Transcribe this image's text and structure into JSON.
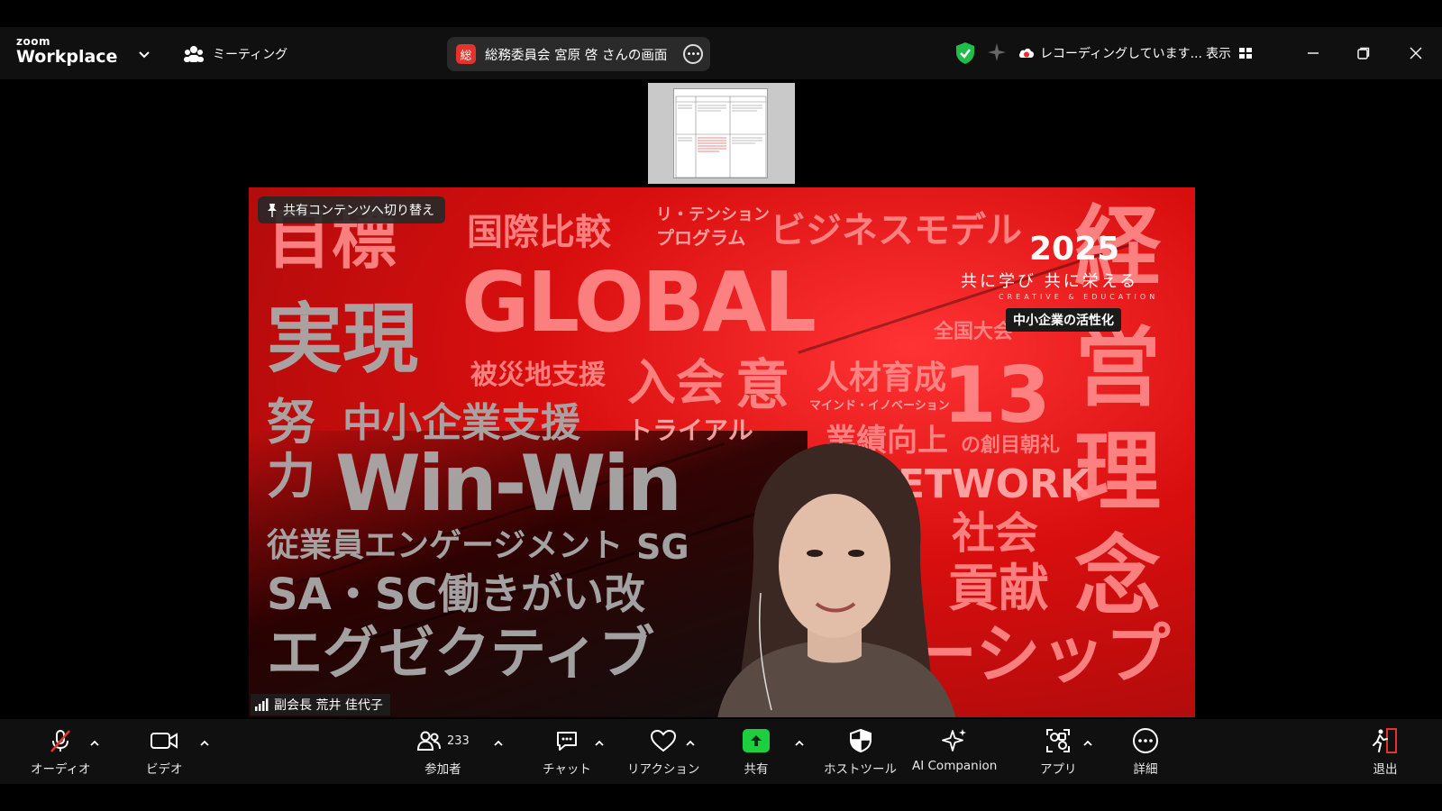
{
  "window": {
    "logo_top": "zoom",
    "logo_bottom": "Workplace",
    "meeting_label": "ミーティング",
    "share_badge": "総",
    "share_title": "総務委員会 宮原 啓 さんの画面",
    "recording_text": "レコーディングしています...",
    "view_label": "表示"
  },
  "content": {
    "switch_chip": "共有コンテンツへ切り替え",
    "slide_year": "2025",
    "slide_tagline": "共に学び 共に栄える",
    "slide_subtag": "CREATIVE & EDUCATION",
    "slide_badge": "中小企業の活性化",
    "slide_words": [
      "目標",
      "国際比較",
      "リ・テンション",
      "プログラム",
      "ビジネスモデル",
      "経",
      "GLOBAL",
      "実現",
      "被災地支援",
      "入会",
      "意",
      "人材育成",
      "マインド・イノベーション",
      "13",
      "営",
      "努",
      "中小企業支援",
      "トライアル",
      "業績向上",
      "の創目朝礼",
      "力",
      "Win-Win",
      "ETWORK",
      "理",
      "従業員エンゲージメント",
      "SG",
      "社会",
      "SA・SC",
      "働きがい改",
      "貢献",
      "念",
      "エグゼクティブ",
      "ーシップ",
      "全国大会"
    ],
    "speaker_name": "副会長 荒井 佳代子"
  },
  "toolbar": {
    "audio": "オーディオ",
    "video": "ビデオ",
    "participants": "参加者",
    "participant_count": "233",
    "chat": "チャット",
    "reactions": "リアクション",
    "share": "共有",
    "host_tools": "ホストツール",
    "ai_companion": "AI Companion",
    "apps": "アプリ",
    "more": "詳細",
    "leave": "退出"
  },
  "colors": {
    "share_green": "#1fce3f",
    "badge_red": "#e5322c",
    "shield_green": "#1fbe4a",
    "leave_red": "#e5322c"
  }
}
